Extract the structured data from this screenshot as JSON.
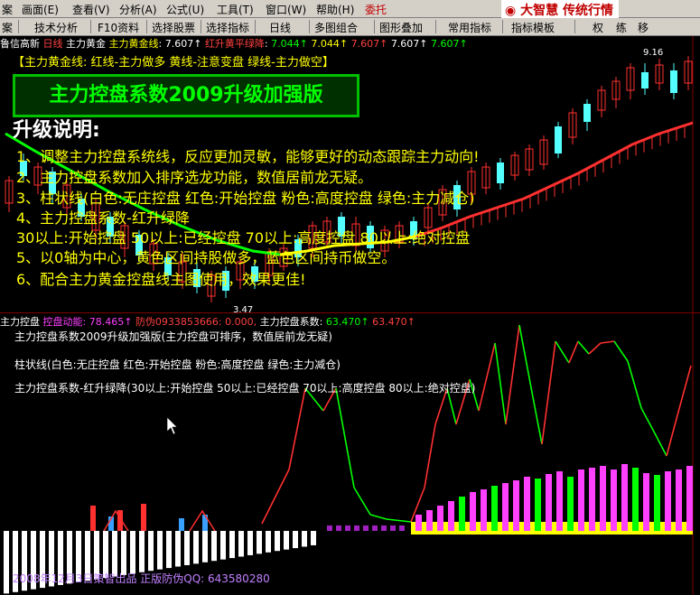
{
  "menubar": {
    "items": [
      "案",
      "画面(E)",
      "查看(V)",
      "分析(A)",
      "公式(U)",
      "工具(T)",
      "窗口(W)",
      "帮助(H)"
    ],
    "tag": "委托",
    "brand": "大智慧",
    "brand_sub": "传统行情"
  },
  "toolbar": {
    "items": [
      "技术分析",
      "F10资料",
      "选择股票",
      "选择指标",
      "日线",
      "多图组合",
      "图形叠加",
      "常用指标",
      "指标模板"
    ],
    "right_items": [
      "权",
      "练",
      "移"
    ]
  },
  "status1": {
    "stock": "鲁信高新",
    "period": "日线",
    "indicator": "主力黄金",
    "line1_label": "主力黄金线",
    "line1_value": "7.607↑",
    "line2_label": "红升黄平绿降",
    "line2_values": [
      "7.044↑",
      "7.044↑",
      "7.607↑",
      "7.607↑",
      "7.607↑"
    ]
  },
  "legend": "【主力黄金线: 红线-主力做多  黄线-注意变盘  绿线-主力做空】",
  "banner": "主力控盘系数2009升级加强版",
  "upgrade": {
    "title": "升级说明:",
    "notes": [
      "1、调整主力控盘系统线，反应更加灵敏，能够更好的动态跟踪主力动向!",
      "2、主力控盘系数加入排序选龙功能，数值居前龙无疑。",
      "3、柱状线(白色:无庄控盘 红色:开始控盘 粉色:高度控盘 绿色:主力减仓)",
      "4、主力控盘系数-红升绿降",
      "   30以上:开始控盘 50以上:已经控盘 70以上:高度控盘 80以上:绝对控盘",
      "5、以0轴为中心，黄色区间持股做多，蓝色区间持币做空。",
      "6、配合主力黄金控盘线主图使用，效果更佳!"
    ]
  },
  "price_labels": {
    "high": "9.16",
    "low": "3.47"
  },
  "status2": {
    "title": "主力控盘",
    "momentum_label": "控盘动能:",
    "momentum_value": "78.465↑",
    "fake_label": "防伪0933853666:",
    "fake_value": "0.000,",
    "coef_label": "主力控盘系数:",
    "coef_values": [
      "63.470↑",
      "63.470↑"
    ]
  },
  "indicator_text": [
    "主力控盘系数2009升级加强版(主力控盘可排序，数值居前龙无疑)",
    "柱状线(白色:无庄控盘 红色:开始控盘 粉色:高度控盘 绿色:主力减仓)",
    "主力控盘系数-红升绿降(30以上:开始控盘 50以上:已经控盘 70以上:高度控盘 80以上:绝对控盘)"
  ],
  "footer": "2008年12月3日策智出品  正版防伪QQ:  643580280",
  "colors": {
    "up": "#ff3030",
    "down": "#54ffff",
    "yellow": "#ffff00",
    "green": "#00ff00",
    "magenta": "#ff40ff",
    "white": "#ffffff"
  }
}
